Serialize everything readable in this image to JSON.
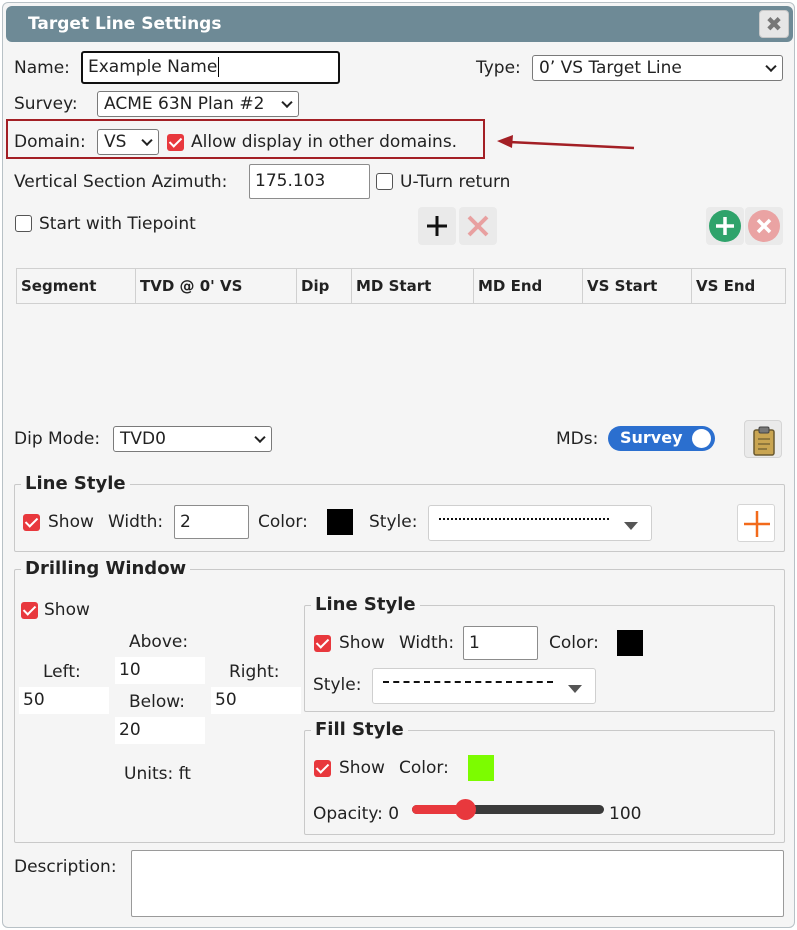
{
  "dialog": {
    "title": "Target Line Settings",
    "close_symbol": "✖"
  },
  "name": {
    "label": "Name:",
    "value": "Example Name"
  },
  "type": {
    "label": "Type:",
    "value": "0’ VS Target Line"
  },
  "survey": {
    "label": "Survey:",
    "value": "ACME 63N Plan #2"
  },
  "domain": {
    "label": "Domain:",
    "value": "VS",
    "allow_display_label": "Allow display in other domains.",
    "allow_display_checked": true,
    "highlight_color": "#a31f25"
  },
  "azimuth": {
    "label": "Vertical Section Azimuth:",
    "value": "175.103",
    "uturn_label": "U-Turn return",
    "uturn_checked": false
  },
  "tiepoint": {
    "label": "Start with Tiepoint",
    "checked": false
  },
  "icons": {
    "add_segment": "plus-icon",
    "remove_segment": "x-icon",
    "add_green": "plus-circle-icon",
    "remove_red": "x-circle-icon",
    "clipboard": "clipboard-icon",
    "add_style": "plus-icon",
    "green_color": "#2fa36b",
    "red_color": "#e8a0a0",
    "orange_color": "#f26a1b"
  },
  "table": {
    "columns": [
      "Segment",
      "TVD @ 0' VS",
      "Dip",
      "MD Start",
      "MD End",
      "VS Start",
      "VS End"
    ],
    "rows": []
  },
  "dip_mode": {
    "label": "Dip Mode:",
    "value": "TVD0"
  },
  "mds": {
    "label": "MDs:",
    "toggle_label": "Survey",
    "toggle_on": true,
    "toggle_color": "#2b6fcf"
  },
  "line_style": {
    "legend": "Line Style",
    "show_label": "Show",
    "show_checked": true,
    "width_label": "Width:",
    "width_value": "2",
    "color_label": "Color:",
    "color": "#000000",
    "style_label": "Style:"
  },
  "drilling_window": {
    "legend": "Drilling Window",
    "show_label": "Show",
    "show_checked": true,
    "above_label": "Above:",
    "above_value": "10",
    "left_label": "Left:",
    "left_value": "50",
    "right_label": "Right:",
    "right_value": "50",
    "below_label": "Below:",
    "below_value": "20",
    "units_label": "Units: ft",
    "line_style": {
      "legend": "Line Style",
      "show_label": "Show",
      "show_checked": true,
      "width_label": "Width:",
      "width_value": "1",
      "color_label": "Color:",
      "color": "#000000",
      "style_label": "Style:"
    },
    "fill_style": {
      "legend": "Fill Style",
      "show_label": "Show",
      "show_checked": true,
      "color_label": "Color:",
      "color": "#7cfc00",
      "opacity_label": "Opacity: 0",
      "opacity_max_label": "100",
      "opacity_value": 25
    }
  },
  "description": {
    "label": "Description:",
    "value": ""
  }
}
